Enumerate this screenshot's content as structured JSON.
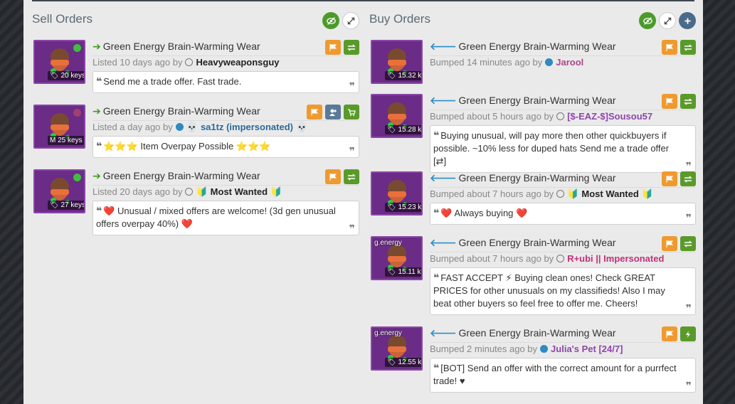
{
  "sell": {
    "title": "Sell Orders",
    "listings": [
      {
        "item": "Green Energy Brain-Warming Wear",
        "price": "20 keys",
        "status_text": "Listed 10 days ago by",
        "user": "Heavyweaponsguy",
        "user_color": "#222222",
        "message": "Send me a trade offer. Fast trade."
      },
      {
        "item": "Green Energy Brain-Warming Wear",
        "price": "25 keys",
        "status_text": "Listed a day ago by",
        "user": "sa1tz (impersonated)",
        "user_color": "#2a6a9a",
        "message": "Item Overpay Possible"
      },
      {
        "item": "Green Energy Brain-Warming Wear",
        "price": "27 keys",
        "status_text": "Listed 20 days ago by",
        "user": "Most Wanted",
        "user_color": "#222222",
        "message": "Unusual / mixed offers are welcome! (3d gen unusual offers overpay 40%)"
      }
    ]
  },
  "buy": {
    "title": "Buy Orders",
    "listings": [
      {
        "item": "Green Energy Brain-Warming Wear",
        "price": "15.32 keys",
        "status_text": "Bumped 14 minutes ago by",
        "user": "Jarool",
        "user_color": "#b0458a",
        "message": "",
        "caption": ""
      },
      {
        "item": "Green Energy Brain-Warming Wear",
        "price": "15.28 keys",
        "status_text": "Bumped about 5 hours ago by",
        "user": "[$-EAZ-$]Sousou57",
        "user_color": "#8e44ad",
        "message": "Buying unusual, will pay more then other quickbuyers if possible. ~10% less for duped hats Send me a trade offer [⇄]",
        "caption": ""
      },
      {
        "item": "Green Energy Brain-Warming Wear",
        "price": "15.23 keys",
        "status_text": "Bumped about 7 hours ago by",
        "user": "Most Wanted",
        "user_color": "#222222",
        "message": "Always buying",
        "caption": ""
      },
      {
        "item": "Green Energy Brain-Warming Wear",
        "price": "15.11 keys",
        "status_text": "Bumped about 7 hours ago by",
        "user": "R+ubi || Impersonated",
        "user_color": "#c0307a",
        "message": "FAST ACCEPT ⚡ Buying clean ones! Check GREAT PRICES for other unusuals on my classifieds! Also I may beat other buyers so feel free to offer me. Cheers!",
        "caption": "g.energy"
      },
      {
        "item": "Green Energy Brain-Warming Wear",
        "price": "12.55 keys",
        "status_text": "Bumped 2 minutes ago by",
        "user": "Julia's Pet [24/7]",
        "user_color": "#8e44ad",
        "message": "[BOT] Send an offer with the correct amount for a purrfect trade! ♥",
        "caption": "g.energy"
      }
    ]
  },
  "glyphs": {
    "quote_open": "❝",
    "quote_close": "❞",
    "skull": "💀",
    "star": "⭐",
    "heart": "❤️",
    "leaf": "🔰",
    "bolt": "⚡"
  }
}
